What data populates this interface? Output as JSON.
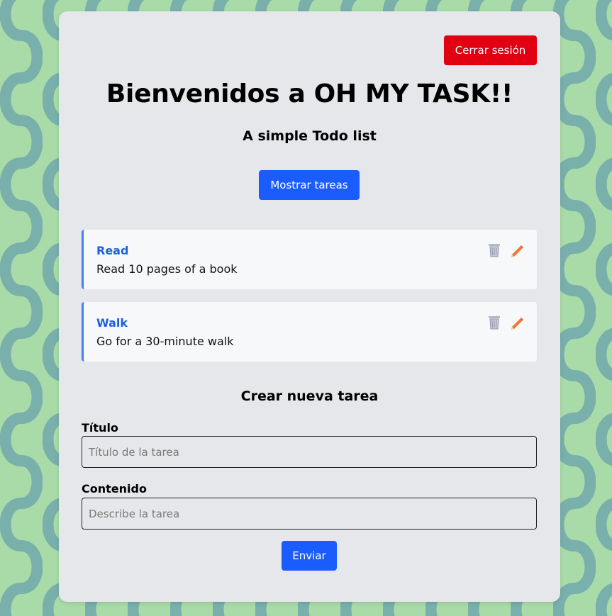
{
  "header": {
    "logout_label": "Cerrar sesión",
    "title": "Bienvenidos a OH MY TASK!!",
    "subtitle": "A simple Todo list",
    "show_tasks_label": "Mostrar tareas"
  },
  "tasks": [
    {
      "title": "Read",
      "description": "Read 10 pages of a book",
      "delete_icon": "trash-icon",
      "edit_icon": "pencil-icon"
    },
    {
      "title": "Walk",
      "description": "Go for a 30-minute walk",
      "delete_icon": "trash-icon",
      "edit_icon": "pencil-icon"
    }
  ],
  "form": {
    "heading": "Crear nueva tarea",
    "title_label": "Título",
    "title_placeholder": "Título de la tarea",
    "title_value": "",
    "content_label": "Contenido",
    "content_placeholder": "Describe la tarea",
    "content_value": "",
    "submit_label": "Enviar"
  },
  "colors": {
    "background_green": "#a8dba8",
    "pattern_teal": "#79b0ac",
    "card_bg": "#e6e7ea",
    "danger": "#e00012",
    "primary": "#1a5dfc",
    "task_title": "#1d5fe0",
    "task_border": "#3b82f6",
    "edit_icon": "#ee7a35",
    "trash_icon": "#9aa0b4"
  }
}
